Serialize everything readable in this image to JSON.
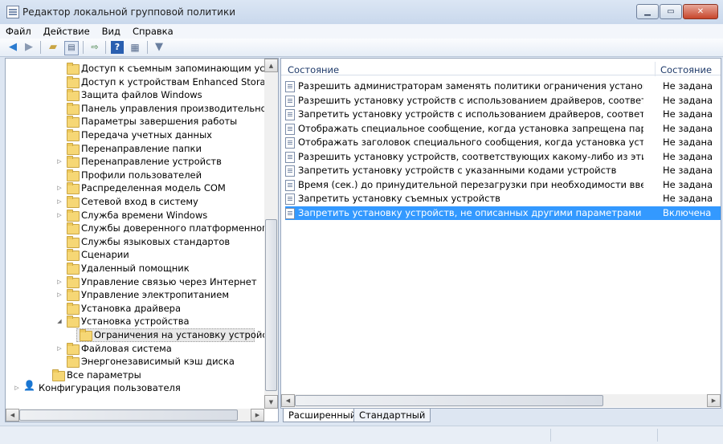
{
  "window": {
    "title": "Редактор локальной групповой политики",
    "buttons": [
      "minimize",
      "maximize",
      "close"
    ]
  },
  "menu": [
    "Файл",
    "Действие",
    "Вид",
    "Справка"
  ],
  "toolbar": {
    "icons": [
      "back-arrow-icon",
      "forward-arrow-icon",
      "up-folder-icon",
      "show-hide-tree-icon",
      "export-list-icon",
      "help-icon",
      "properties-icon",
      "filter-icon"
    ]
  },
  "tree": {
    "items": [
      {
        "label": "Доступ к съемным запоминающим устройствам",
        "expander": ""
      },
      {
        "label": "Доступ к устройствам Enhanced Storage",
        "expander": ""
      },
      {
        "label": "Защита файлов Windows",
        "expander": ""
      },
      {
        "label": "Панель управления производительностью",
        "expander": ""
      },
      {
        "label": "Параметры завершения работы",
        "expander": ""
      },
      {
        "label": "Передача учетных данных",
        "expander": ""
      },
      {
        "label": "Перенаправление папки",
        "expander": ""
      },
      {
        "label": "Перенаправление устройств",
        "expander": "▷"
      },
      {
        "label": "Профили пользователей",
        "expander": ""
      },
      {
        "label": "Распределенная модель COM",
        "expander": "▷"
      },
      {
        "label": "Сетевой вход в систему",
        "expander": "▷"
      },
      {
        "label": "Служба времени Windows",
        "expander": "▷"
      },
      {
        "label": "Службы доверенного платформенного модуля",
        "expander": ""
      },
      {
        "label": "Службы языковых стандартов",
        "expander": ""
      },
      {
        "label": "Сценарии",
        "expander": ""
      },
      {
        "label": "Удаленный помощник",
        "expander": ""
      },
      {
        "label": "Управление связью через Интернет",
        "expander": "▷"
      },
      {
        "label": "Управление электропитанием",
        "expander": "▷"
      },
      {
        "label": "Установка драйвера",
        "expander": ""
      },
      {
        "label": "Установка устройства",
        "expander": "◢"
      }
    ],
    "selected_child": "Ограничения на установку устройств",
    "after": [
      {
        "label": "Файловая система",
        "expander": "▷"
      },
      {
        "label": "Энергонезависимый кэш диска",
        "expander": ""
      }
    ],
    "all_params": "Все параметры",
    "user_config": "Конфигурация пользователя"
  },
  "list": {
    "column_name": "Состояние",
    "column_state": "Состояние",
    "rows": [
      {
        "name": "Разрешить администраторам заменять политики ограничения установки устройс...",
        "state": "Не задана"
      },
      {
        "name": "Разрешить установку устройств с использованием драйверов, соответствующих ...",
        "state": "Не задана"
      },
      {
        "name": "Запретить установку устройств с использованием драйверов, соответствующих э...",
        "state": "Не задана"
      },
      {
        "name": "Отображать специальное сообщение, когда установка запрещена параметром п...",
        "state": "Не задана"
      },
      {
        "name": "Отображать заголовок специального сообщения, когда установка устройства зап...",
        "state": "Не задана"
      },
      {
        "name": "Разрешить установку устройств, соответствующих какому-либо из этих кодов уст...",
        "state": "Не задана"
      },
      {
        "name": "Запретить установку устройств с указанными кодами устройств",
        "state": "Не задана"
      },
      {
        "name": "Время (сек.) до принудительной перезагрузки при необходимости введения пара...",
        "state": "Не задана"
      },
      {
        "name": "Запретить установку съемных устройств",
        "state": "Не задана"
      },
      {
        "name": "Запретить установку устройств, не описанных другими параметрами политики",
        "state": "Включена"
      }
    ],
    "selected_index": 9
  },
  "tabs": [
    "Расширенный",
    "Стандартный"
  ]
}
